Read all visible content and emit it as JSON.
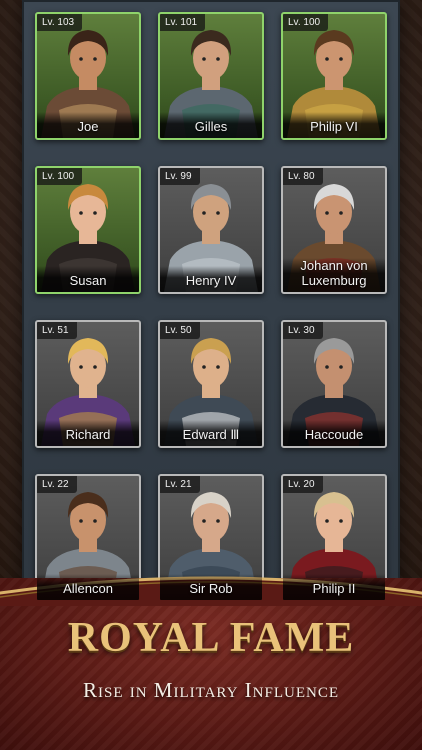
{
  "heroes": [
    {
      "level": "Lv. 103",
      "name": "Joe",
      "frame": "green",
      "skin": "#c58b63",
      "hair": "#3a2418",
      "armor": "#6b4b36",
      "accent": "#c9a36a"
    },
    {
      "level": "Lv. 101",
      "name": "Gilles",
      "frame": "green",
      "skin": "#d1a07e",
      "hair": "#3b2a1e",
      "armor": "#5c6770",
      "accent": "#2f6b5a"
    },
    {
      "level": "Lv. 100",
      "name": "Philip VI",
      "frame": "green",
      "skin": "#cc9570",
      "hair": "#5a3a1f",
      "armor": "#b08a3a",
      "accent": "#d9b24a"
    },
    {
      "level": "Lv. 100",
      "name": "Susan",
      "frame": "green",
      "skin": "#e7b797",
      "hair": "#c8893d",
      "armor": "#2a2422",
      "accent": "#4a4340"
    },
    {
      "level": "Lv. 99",
      "name": "Henry IV",
      "frame": "grey",
      "skin": "#cfa27e",
      "hair": "#8a8f94",
      "armor": "#9aa3aa",
      "accent": "#c9cfd3"
    },
    {
      "level": "Lv. 80",
      "name": "Johann von Luxemburg",
      "frame": "grey",
      "skin": "#c99472",
      "hair": "#d8d8d8",
      "armor": "#6a4a2e",
      "accent": "#8a1f1f"
    },
    {
      "level": "Lv. 51",
      "name": "Richard",
      "frame": "grey",
      "skin": "#e0b38e",
      "hair": "#e2b85a",
      "armor": "#5a3a7a",
      "accent": "#c69a3a"
    },
    {
      "level": "Lv. 50",
      "name": "Edward Ⅲ",
      "frame": "grey",
      "skin": "#ddb08a",
      "hair": "#caa050",
      "armor": "#3f4a55",
      "accent": "#f1f1f1"
    },
    {
      "level": "Lv. 30",
      "name": "Haccoude",
      "frame": "grey",
      "skin": "#c49070",
      "hair": "#9a9a9a",
      "armor": "#262b33",
      "accent": "#b3352c"
    },
    {
      "level": "Lv. 22",
      "name": "Allencon",
      "frame": "grey",
      "skin": "#c8926c",
      "hair": "#4a2e1c",
      "armor": "#7d858c",
      "accent": "#5e3a22"
    },
    {
      "level": "Lv. 21",
      "name": "Sir Rob",
      "frame": "grey",
      "skin": "#d6a88a",
      "hair": "#d8d2c8",
      "armor": "#4f5d6b",
      "accent": "#2e3a48"
    },
    {
      "level": "Lv. 20",
      "name": "Philip II",
      "frame": "grey",
      "skin": "#e6b696",
      "hair": "#d8c090",
      "armor": "#7a1a1f",
      "accent": "#1d1d1d"
    }
  ],
  "banner": {
    "title": "ROYAL FAME",
    "subtitle": "Rise in Military Influence"
  }
}
